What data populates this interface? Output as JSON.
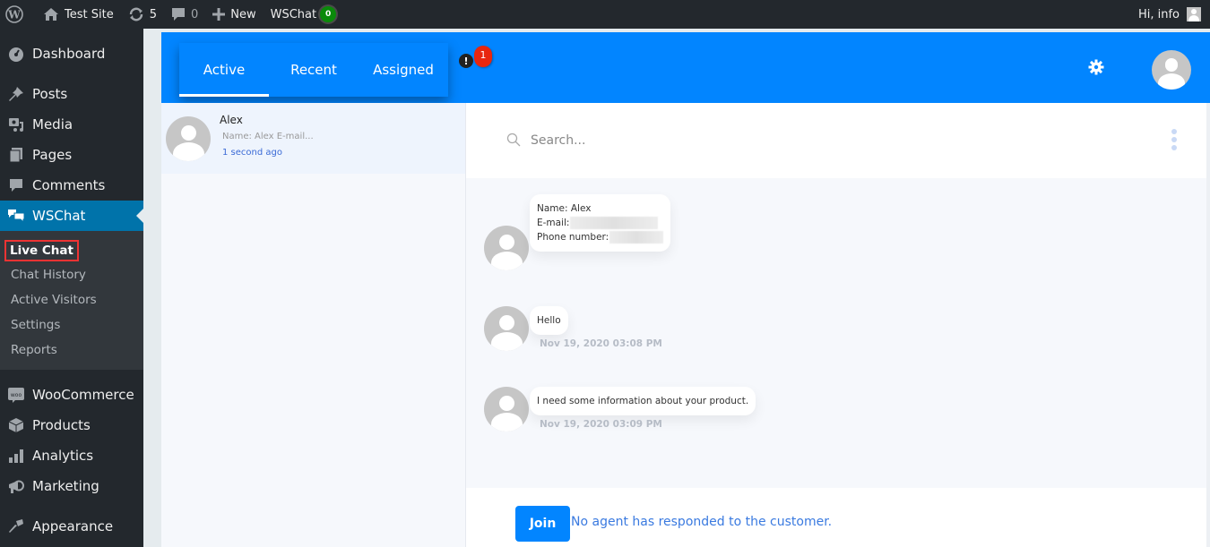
{
  "adminbar": {
    "site_name": "Test Site",
    "updates_count": "5",
    "comments_count": "0",
    "new_label": "New",
    "plugin_label": "WSChat",
    "plugin_badge": "0",
    "greeting": "Hi, info"
  },
  "sidebar": {
    "items": [
      {
        "label": "Dashboard",
        "icon": "dashboard-icon"
      },
      {
        "label": "Posts",
        "icon": "pin-icon"
      },
      {
        "label": "Media",
        "icon": "media-icon"
      },
      {
        "label": "Pages",
        "icon": "pages-icon"
      },
      {
        "label": "Comments",
        "icon": "comment-icon"
      },
      {
        "label": "WSChat",
        "icon": "chat-bubbles-icon",
        "current": true
      },
      {
        "label": "WooCommerce",
        "icon": "woo-icon"
      },
      {
        "label": "Products",
        "icon": "box-icon"
      },
      {
        "label": "Analytics",
        "icon": "bar-chart-icon"
      },
      {
        "label": "Marketing",
        "icon": "megaphone-icon"
      },
      {
        "label": "Appearance",
        "icon": "brush-icon"
      }
    ],
    "submenu": [
      {
        "label": "Live Chat",
        "current": true
      },
      {
        "label": "Chat History"
      },
      {
        "label": "Active Visitors"
      },
      {
        "label": "Settings"
      },
      {
        "label": "Reports"
      }
    ]
  },
  "header": {
    "tabs": [
      {
        "label": "Active",
        "active": true
      },
      {
        "label": "Recent"
      },
      {
        "label": "Assigned"
      }
    ],
    "alert_icon": "!",
    "alert_count": "1"
  },
  "conversations": [
    {
      "name": "Alex",
      "preview": "Name: Alex E-mail...",
      "time": "1 second ago"
    }
  ],
  "chat": {
    "search_placeholder": "Search...",
    "info_card": {
      "name_line": "Name: Alex",
      "email_label": "E-mail:",
      "phone_label": "Phone number:"
    },
    "messages": [
      {
        "text": "Hello",
        "time": "Nov 19, 2020 03:08 PM"
      },
      {
        "text": "I need some information about your product.",
        "time": "Nov 19, 2020 03:09 PM"
      }
    ],
    "join_label": "Join",
    "footer_note": "No agent has responded to the customer."
  },
  "colors": {
    "accent": "#0285ff",
    "wp_admin_dark": "#23282d",
    "wp_current": "#0073aa",
    "badge_red": "#e8260e",
    "badge_green": "#0a8a0a"
  }
}
